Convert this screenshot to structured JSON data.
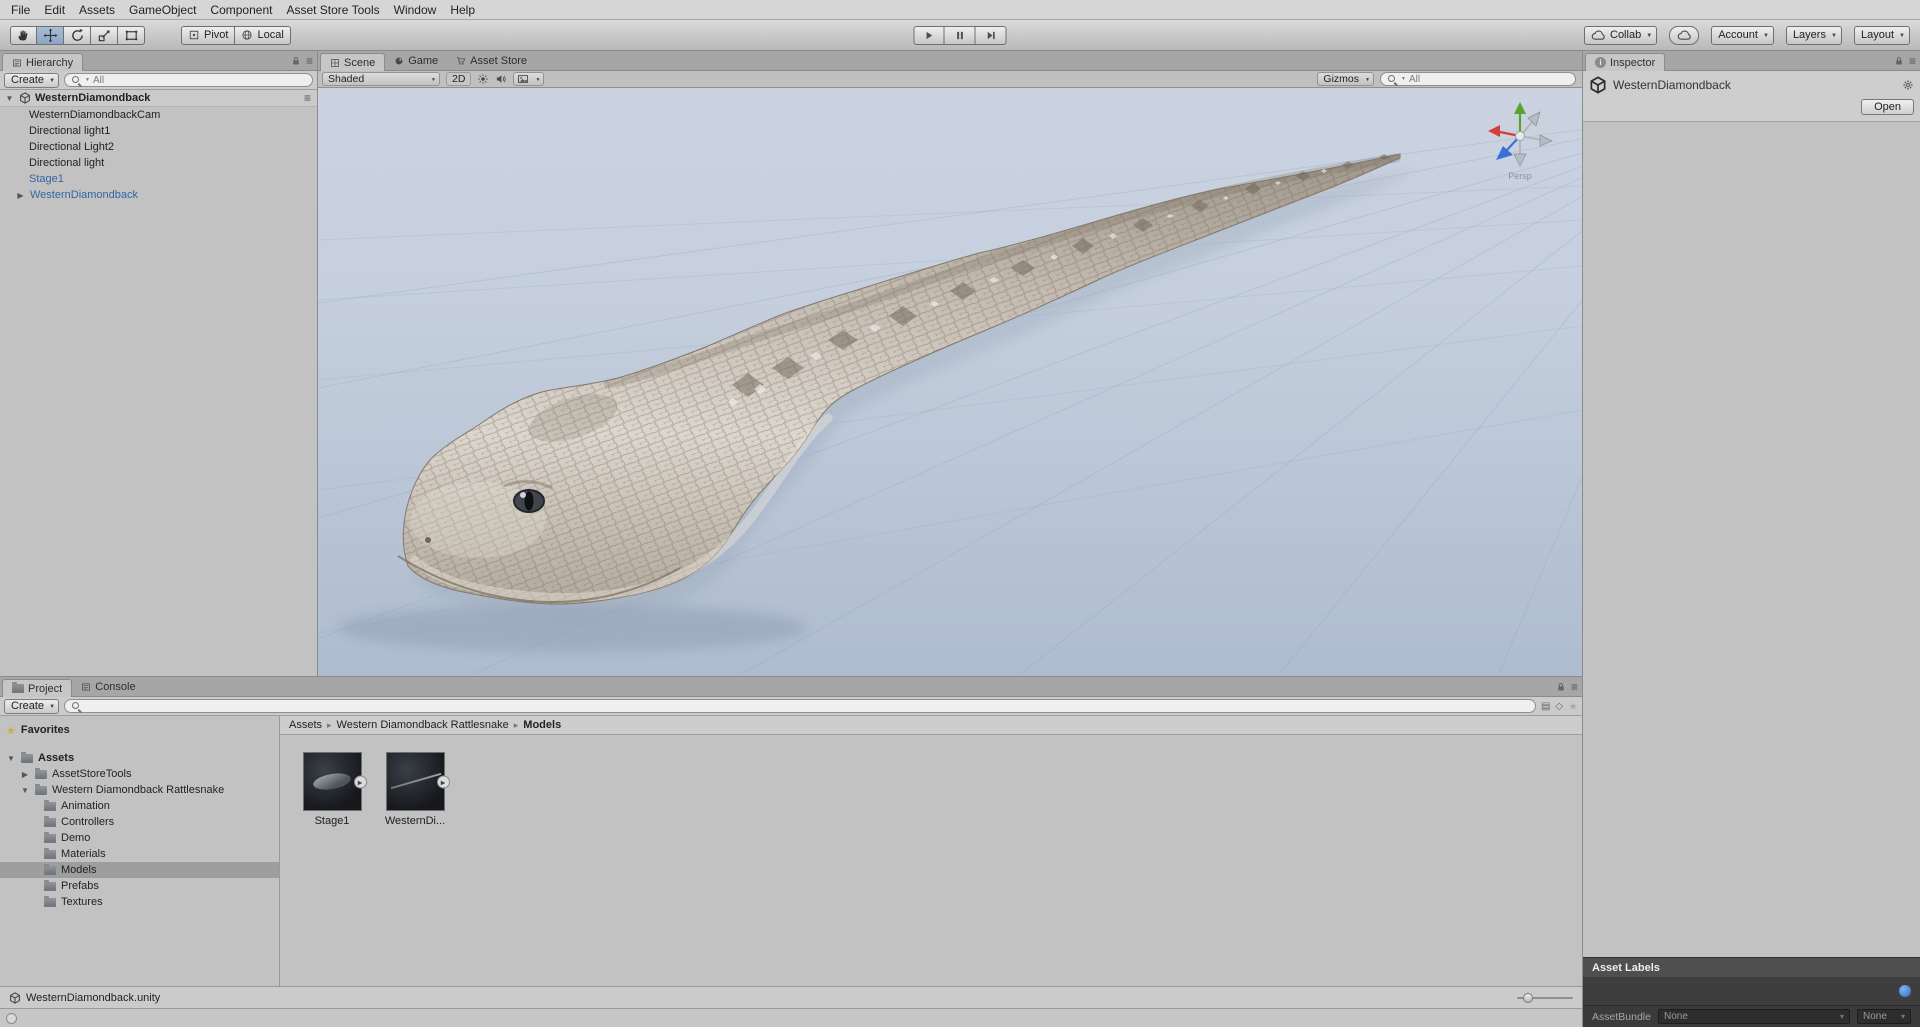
{
  "menu": {
    "items": [
      "File",
      "Edit",
      "Assets",
      "GameObject",
      "Component",
      "Asset Store Tools",
      "Window",
      "Help"
    ]
  },
  "toolbar": {
    "pivot_label": "Pivot",
    "local_label": "Local",
    "collab_label": "Collab",
    "account_label": "Account",
    "layers_label": "Layers",
    "layout_label": "Layout"
  },
  "hierarchy": {
    "title": "Hierarchy",
    "create_label": "Create",
    "search_filter": "All",
    "scene_name": "WesternDiamondback",
    "items": [
      {
        "label": "WesternDiamondbackCam"
      },
      {
        "label": "Directional light1"
      },
      {
        "label": "Directional Light2"
      },
      {
        "label": "Directional light"
      },
      {
        "label": "Stage1"
      },
      {
        "label": "WesternDiamondback"
      }
    ]
  },
  "scene_view": {
    "tabs": [
      "Scene",
      "Game",
      "Asset Store"
    ],
    "shading_mode": "Shaded",
    "toggle_2d": "2D",
    "gizmos_label": "Gizmos",
    "search_filter": "All",
    "persp_label": "Persp"
  },
  "project": {
    "tab_project": "Project",
    "tab_console": "Console",
    "create_label": "Create",
    "favorites_label": "Favorites",
    "folder_assets": "Assets",
    "folder_assetstoretools": "AssetStoreTools",
    "folder_snake": "Western Diamondback Rattlesnake",
    "subfolders": [
      "Animation",
      "Controllers",
      "Demo",
      "Materials",
      "Models",
      "Prefabs",
      "Textures"
    ],
    "breadcrumb": [
      "Assets",
      "Western Diamondback Rattlesnake",
      "Models"
    ],
    "assets": [
      {
        "name": "Stage1"
      },
      {
        "name": "WesternDi..."
      }
    ],
    "status_file": "WesternDiamondback.unity"
  },
  "inspector": {
    "title": "Inspector",
    "object_name": "WesternDiamondback",
    "open_button": "Open",
    "asset_labels_title": "Asset Labels",
    "assetbundle_label": "AssetBundle",
    "bundle_none": "None",
    "variant_none": "None"
  }
}
